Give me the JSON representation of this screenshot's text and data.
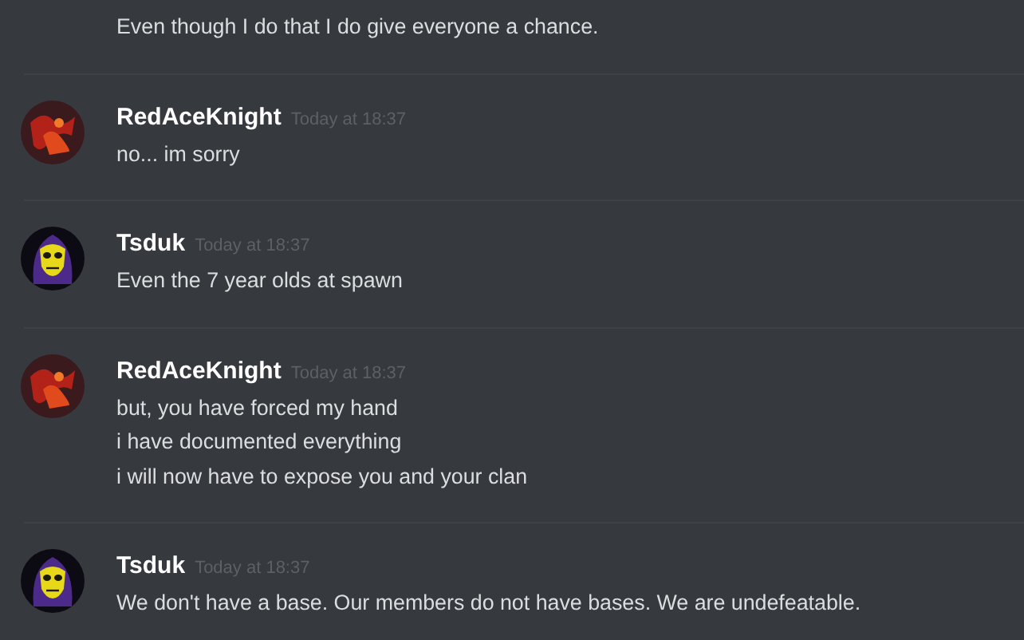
{
  "messages": [
    {
      "kind": "continuation",
      "lines": [
        "Even though I do that I do give everyone a chance."
      ]
    },
    {
      "kind": "fiery",
      "author": "RedAceKnight",
      "timestamp": "Today at 18:37",
      "lines": [
        "no... im sorry"
      ]
    },
    {
      "kind": "skull",
      "author": "Tsduk",
      "timestamp": "Today at 18:37",
      "lines": [
        "Even the 7 year olds at spawn"
      ]
    },
    {
      "kind": "fiery",
      "author": "RedAceKnight",
      "timestamp": "Today at 18:37",
      "lines": [
        "but, you have forced my hand",
        "i have documented everything",
        "i will now have to expose you and your clan"
      ]
    },
    {
      "kind": "skull",
      "author": "Tsduk",
      "timestamp": "Today at 18:37",
      "lines": [
        "We don't have a base. Our members do not have bases. We are undefeatable."
      ]
    }
  ]
}
